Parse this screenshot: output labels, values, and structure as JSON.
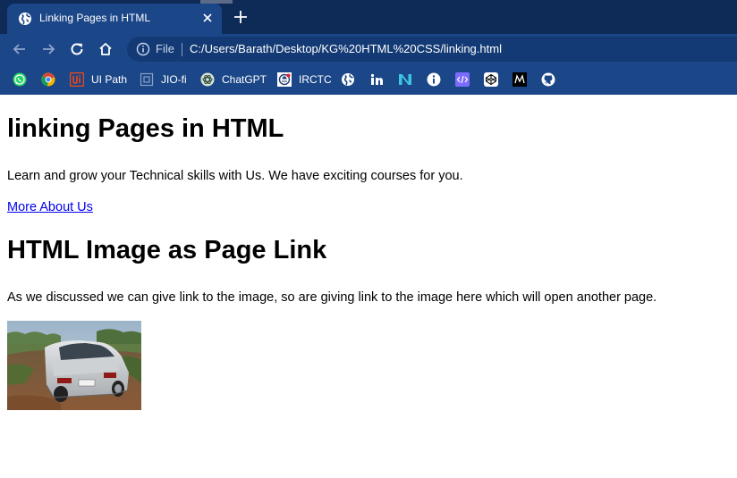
{
  "browser": {
    "tab": {
      "title": "Linking Pages in HTML",
      "favicon": "globe-icon"
    },
    "new_tab_icon": "plus-icon",
    "toolbar": {
      "back_icon": "arrow-left-icon",
      "forward_icon": "arrow-right-icon",
      "reload_icon": "reload-icon",
      "home_icon": "home-icon"
    },
    "address_bar": {
      "scheme_label": "File",
      "url": "C:/Users/Barath/Desktop/KG%20HTML%20CSS/linking.html"
    },
    "bookmarks": [
      {
        "label": "",
        "icon": "whatsapp-icon"
      },
      {
        "label": "",
        "icon": "chrome-web-icon"
      },
      {
        "label": "UI Path",
        "icon": "uipath-icon"
      },
      {
        "label": "JIO-fi",
        "icon": "jiofi-icon"
      },
      {
        "label": "ChatGPT",
        "icon": "chatgpt-icon"
      },
      {
        "label": "IRCTC",
        "icon": "irctc-icon"
      },
      {
        "label": "",
        "icon": "globe-icon"
      },
      {
        "label": "",
        "icon": "linkedin-icon"
      },
      {
        "label": "",
        "icon": "notion-icon"
      },
      {
        "label": "",
        "icon": "info-icon"
      },
      {
        "label": "",
        "icon": "code-icon"
      },
      {
        "label": "",
        "icon": "codepen-icon"
      },
      {
        "label": "",
        "icon": "medium-icon"
      },
      {
        "label": "",
        "icon": "github-icon"
      }
    ],
    "colors": {
      "titlebar": "#0e2a57",
      "toolbar": "#1b4688",
      "link": "#0000ee"
    }
  },
  "page": {
    "heading1": "linking Pages in HTML",
    "paragraph1": "Learn and grow your Technical skills with Us. We have exciting courses for you.",
    "link1": "More About Us",
    "heading2": "HTML Image as Page Link",
    "paragraph2": "As we discussed we can give link to the image, so are giving link to the image here which will open another page.",
    "image_link": {
      "alt": "silver car photo"
    }
  }
}
